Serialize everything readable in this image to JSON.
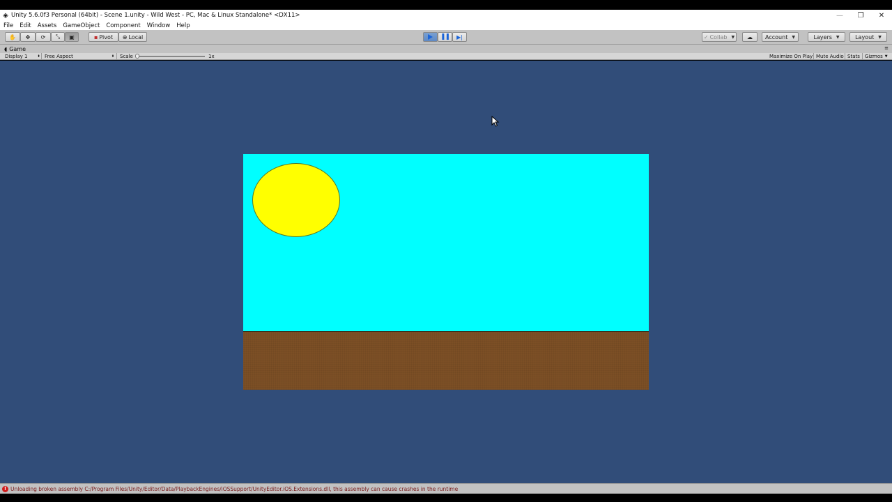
{
  "window": {
    "title": "Unity 5.6.0f3 Personal (64bit) - Scene 1.unity - Wild West - PC, Mac & Linux Standalone* <DX11>"
  },
  "menu": [
    "File",
    "Edit",
    "Assets",
    "GameObject",
    "Component",
    "Window",
    "Help"
  ],
  "toolbar": {
    "pivot_label": "Pivot",
    "local_label": "Local",
    "collab_label": "Collab",
    "account_label": "Account",
    "layers_label": "Layers",
    "layout_label": "Layout"
  },
  "game_tab": {
    "label": "Game"
  },
  "game_bar": {
    "display_label": "Display 1",
    "aspect_label": "Free Aspect",
    "scale_label": "Scale",
    "scale_value": "1x",
    "maximize_label": "Maximize On Play",
    "mute_label": "Mute Audio",
    "stats_label": "Stats",
    "gizmos_label": "Gizmos"
  },
  "status": {
    "message": "Unloading broken assembly C:/Program Files/Unity/Editor/Data/PlaybackEngines/iOSSupport/UnityEditor.iOS.Extensions.dll, this assembly can cause crashes in the runtime"
  },
  "colors": {
    "viewport_bg": "#314d79",
    "sky": "#00ffff",
    "ground": "#7c4f25",
    "sun": "#ffff00",
    "play_active": "#1a64d8",
    "error": "#d01c1c"
  }
}
